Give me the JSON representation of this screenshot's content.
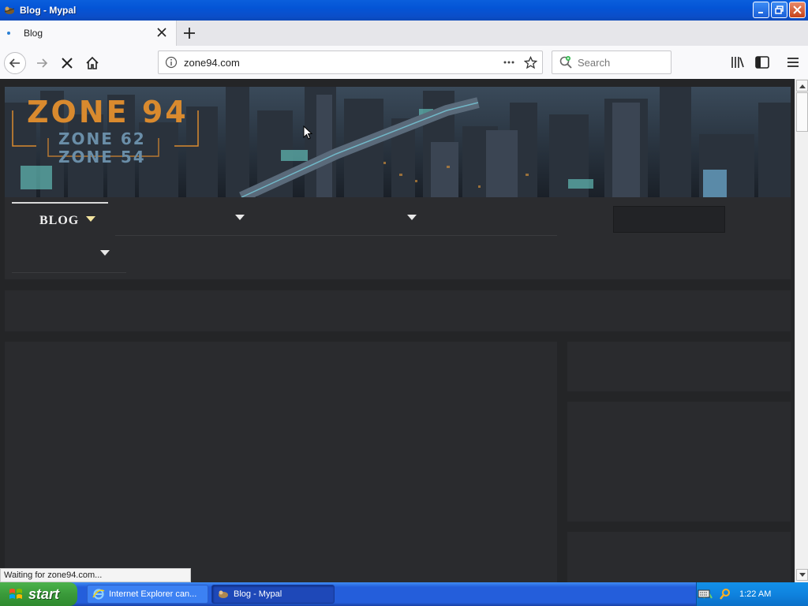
{
  "window": {
    "title": "Blog - Mypal"
  },
  "browser": {
    "tab": {
      "label": "Blog"
    },
    "url": "zone94.com",
    "search": {
      "placeholder": "Search"
    },
    "status_text": "Waiting for zone94.com..."
  },
  "page": {
    "logo_text": [
      "ZONE 94",
      "ZONE 62",
      "ZONE 54"
    ],
    "nav": {
      "first_item_label": "BLOG"
    }
  },
  "taskbar": {
    "start_label": "start",
    "tasks": [
      {
        "label": "Internet Explorer can...",
        "icon": "ie-icon"
      },
      {
        "label": "Blog - Mypal",
        "icon": "mypal-icon"
      }
    ],
    "clock": "1:22 AM"
  },
  "colors": {
    "titlebar": "#0454d6",
    "page_bg": "#242527",
    "panel_bg": "#2a2b2e",
    "nav_accent": "#f4e5a0",
    "logo_orange": "#d98a2e",
    "logo_steel": "#6a8ea8"
  }
}
